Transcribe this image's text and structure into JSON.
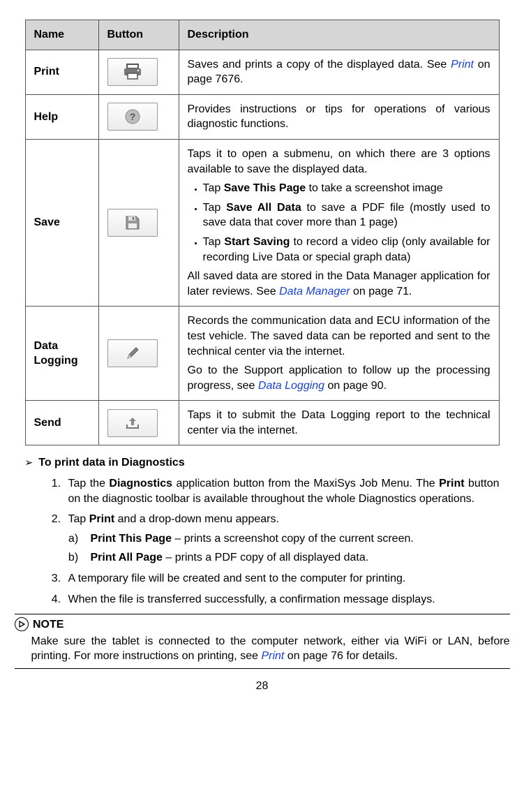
{
  "table": {
    "headers": {
      "name": "Name",
      "button": "Button",
      "desc": "Description"
    },
    "rows": {
      "print": {
        "name": "Print",
        "desc_a": "Saves and prints a copy of the displayed data. See ",
        "desc_link": "Print",
        "desc_b": " on page 7676."
      },
      "help": {
        "name": "Help",
        "desc": "Provides instructions or tips for operations of various diagnostic functions."
      },
      "save": {
        "name": "Save",
        "p1": "Taps it to open a submenu, on which there are 3 options available to save the displayed data.",
        "b1_a": "Tap ",
        "b1_bold": "Save This Page",
        "b1_b": " to take a screenshot image",
        "b2_a": "Tap ",
        "b2_bold": "Save All Data",
        "b2_b": " to save a PDF file (mostly used to save data that cover more than 1 page)",
        "b3_a": "Tap ",
        "b3_bold": "Start Saving",
        "b3_b": " to record a video clip (only available for recording Live Data or special graph data)",
        "p2_a": "All saved data are stored in the Data Manager application for later reviews. See ",
        "p2_link": "Data Manager",
        "p2_b": " on page 71."
      },
      "datalog": {
        "name": "Data Logging",
        "p1": "Records the communication data and ECU information of the test vehicle. The saved data can be reported and sent to the technical center via the internet.",
        "p2_a": "Go to the Support application to follow up the processing progress, see ",
        "p2_link": "Data Logging",
        "p2_b": " on page 90."
      },
      "send": {
        "name": "Send",
        "desc": "Taps it to submit the Data Logging report to the technical center via the internet."
      }
    }
  },
  "procedure": {
    "title": "To print data in Diagnostics",
    "step1_a": "Tap the ",
    "step1_bold1": "Diagnostics",
    "step1_b": " application button from the MaxiSys Job Menu. The ",
    "step1_bold2": "Print",
    "step1_c": " button on the diagnostic toolbar is available throughout the whole Diagnostics operations.",
    "step2_a": "Tap ",
    "step2_bold": "Print",
    "step2_b": " and a drop-down menu appears.",
    "sub_a_bold": "Print This Page",
    "sub_a_rest": " – prints a screenshot copy of the current screen.",
    "sub_b_bold": "Print All Page",
    "sub_b_rest": " – prints a PDF copy of all displayed data.",
    "step3": "A temporary file will be created and sent to the computer for printing.",
    "step4": "When the file is transferred successfully, a confirmation message displays."
  },
  "note": {
    "label": "NOTE",
    "body_a": "Make sure the tablet is connected to the computer network, either via WiFi or LAN, before printing. For more instructions on printing, see ",
    "body_link": "Print",
    "body_b": " on page 76 for details."
  },
  "page_number": "28"
}
